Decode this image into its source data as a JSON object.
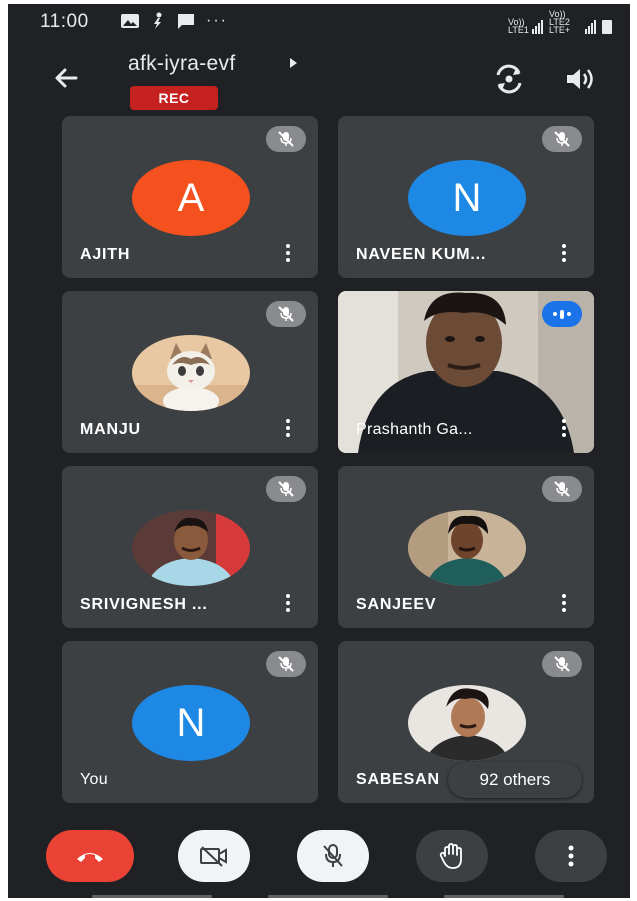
{
  "status_bar": {
    "time": "11:00",
    "network_labels": [
      "Vo)) LTE1",
      "Vo)) LTE2 LTE+"
    ]
  },
  "meeting": {
    "title": "afk-iyra-evf",
    "rec_label": "REC"
  },
  "participants": [
    {
      "name": "AJITH",
      "avatar_letter": "A",
      "avatar_color": "#f4511e",
      "muted": true
    },
    {
      "name": "NAVEEN KUM...",
      "avatar_letter": "N",
      "avatar_color": "#1e88e5",
      "muted": true
    },
    {
      "name": "MANJU",
      "avatar": "cat-photo",
      "muted": true
    },
    {
      "name": "Prashanth Ga...",
      "video": "live-video",
      "speaking": true
    },
    {
      "name": "SRIVIGNESH ...",
      "avatar": "person-photo",
      "muted": true
    },
    {
      "name": "SANJEEV",
      "avatar": "person-photo",
      "muted": true
    },
    {
      "name": "You",
      "avatar_letter": "N",
      "avatar_color": "#1e88e5",
      "muted": true
    },
    {
      "name": "SABESAN",
      "avatar": "person-photo",
      "muted": true
    }
  ],
  "others_label": "92 others",
  "controls": {
    "end_call": {
      "icon": "hang-up-icon",
      "color": "#ea4335"
    },
    "camera": {
      "icon": "camera-off-icon"
    },
    "mic": {
      "icon": "mic-off-icon"
    },
    "raise_hand": {
      "icon": "hand-icon"
    },
    "more": {
      "icon": "more-vert-icon"
    }
  },
  "colors": {
    "background": "#202124",
    "tile": "#3c4043",
    "accent_blue": "#1a73e8",
    "rec_red": "#c5221f"
  }
}
